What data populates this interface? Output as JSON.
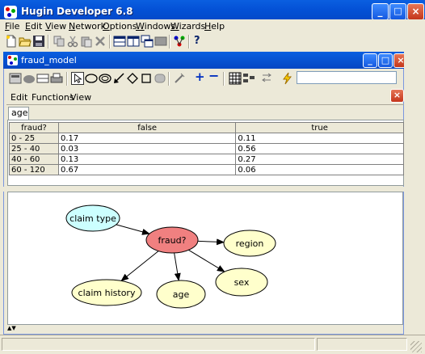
{
  "app": {
    "title": "Hugin Developer 6.8",
    "window_controls": {
      "minimize": "_",
      "maximize": "□",
      "close": "×"
    }
  },
  "menubar": [
    {
      "label": "File",
      "u": "F",
      "rest": "ile"
    },
    {
      "label": "Edit",
      "u": "E",
      "rest": "dit"
    },
    {
      "label": "View",
      "u": "V",
      "rest": "iew"
    },
    {
      "label": "Network",
      "u": "N",
      "rest": "etwork"
    },
    {
      "label": "Options",
      "u": "O",
      "rest": "ptions"
    },
    {
      "label": "Windows",
      "u": "W",
      "rest": "indows"
    },
    {
      "label": "Wizards",
      "u": "W",
      "rest": "izards"
    },
    {
      "label": "Help",
      "u": "H",
      "rest": "elp"
    }
  ],
  "toolbar_icons": [
    "new-file-icon",
    "open-folder-icon",
    "save-icon",
    "copy-icon",
    "cut-icon",
    "paste-icon",
    "delete-icon",
    "layout-icon-1",
    "layout-icon-2",
    "layout-icon-3",
    "layout-icon-4",
    "network-wizard-icon",
    "help-icon"
  ],
  "help_glyph": "?",
  "document": {
    "title": "fraud_model",
    "search_value": "",
    "submenu": [
      "Edit",
      "Functions",
      "View"
    ],
    "tab_label": "age",
    "table": {
      "corner": "fraud?",
      "columns": [
        "false",
        "true"
      ],
      "rows": [
        {
          "label": "0 - 25",
          "values": [
            "0.17",
            "0.11"
          ]
        },
        {
          "label": "25 - 40",
          "values": [
            "0.03",
            "0.56"
          ]
        },
        {
          "label": "40 - 60",
          "values": [
            "0.13",
            "0.27"
          ]
        },
        {
          "label": "60 - 120",
          "values": [
            "0.67",
            "0.06"
          ]
        }
      ]
    },
    "network": {
      "nodes": [
        {
          "id": "claim_type",
          "label": "claim type",
          "color": "#CCFFFF"
        },
        {
          "id": "fraud",
          "label": "fraud?",
          "color": "#F08080"
        },
        {
          "id": "region",
          "label": "region",
          "color": "#FFFFCC"
        },
        {
          "id": "claim_history",
          "label": "claim history",
          "color": "#FFFFCC"
        },
        {
          "id": "age",
          "label": "age",
          "color": "#FFFFCC"
        },
        {
          "id": "sex",
          "label": "sex",
          "color": "#FFFFCC"
        }
      ],
      "edges": [
        [
          "claim_type",
          "fraud"
        ],
        [
          "fraud",
          "region"
        ],
        [
          "fraud",
          "claim_history"
        ],
        [
          "fraud",
          "age"
        ],
        [
          "fraud",
          "sex"
        ]
      ]
    }
  },
  "colors": {
    "title_blue": "#0546C3",
    "menu_bg": "#ECE9D8",
    "grid_line": "#808080"
  }
}
